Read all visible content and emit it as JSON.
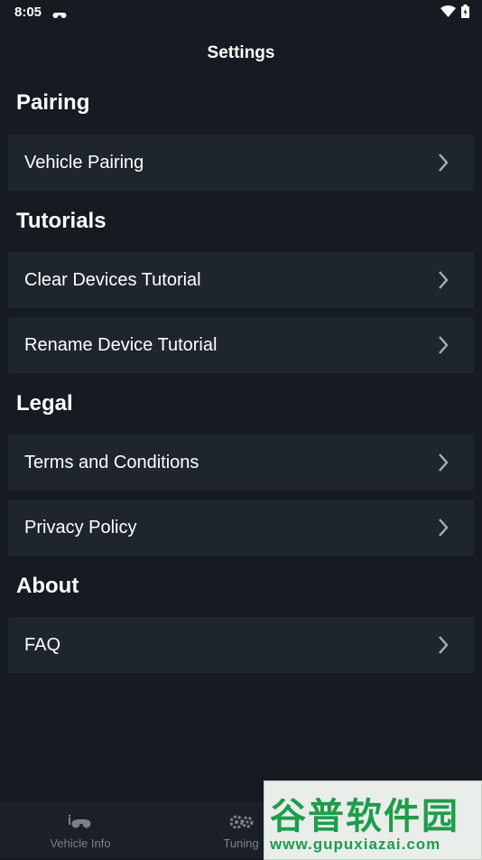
{
  "status": {
    "time": "8:05"
  },
  "header": {
    "title": "Settings"
  },
  "sections": {
    "pairing": {
      "title": "Pairing",
      "items": [
        "Vehicle Pairing"
      ]
    },
    "tutorials": {
      "title": "Tutorials",
      "items": [
        "Clear Devices Tutorial",
        "Rename Device Tutorial"
      ]
    },
    "legal": {
      "title": "Legal",
      "items": [
        "Terms and Conditions",
        "Privacy Policy"
      ]
    },
    "about": {
      "title": "About",
      "items": [
        "FAQ"
      ]
    }
  },
  "bottom_nav": {
    "items": [
      {
        "label": "Vehicle Info",
        "icon": "motorcycle-info-icon"
      },
      {
        "label": "Tuning",
        "icon": "gears-icon"
      }
    ]
  },
  "watermark": {
    "text": "谷普软件园",
    "url": "www.gupuxiazai.com"
  },
  "colors": {
    "background": "#161b22",
    "row": "#1f252d",
    "nav": "#1b2027",
    "muted": "#7b8189"
  }
}
